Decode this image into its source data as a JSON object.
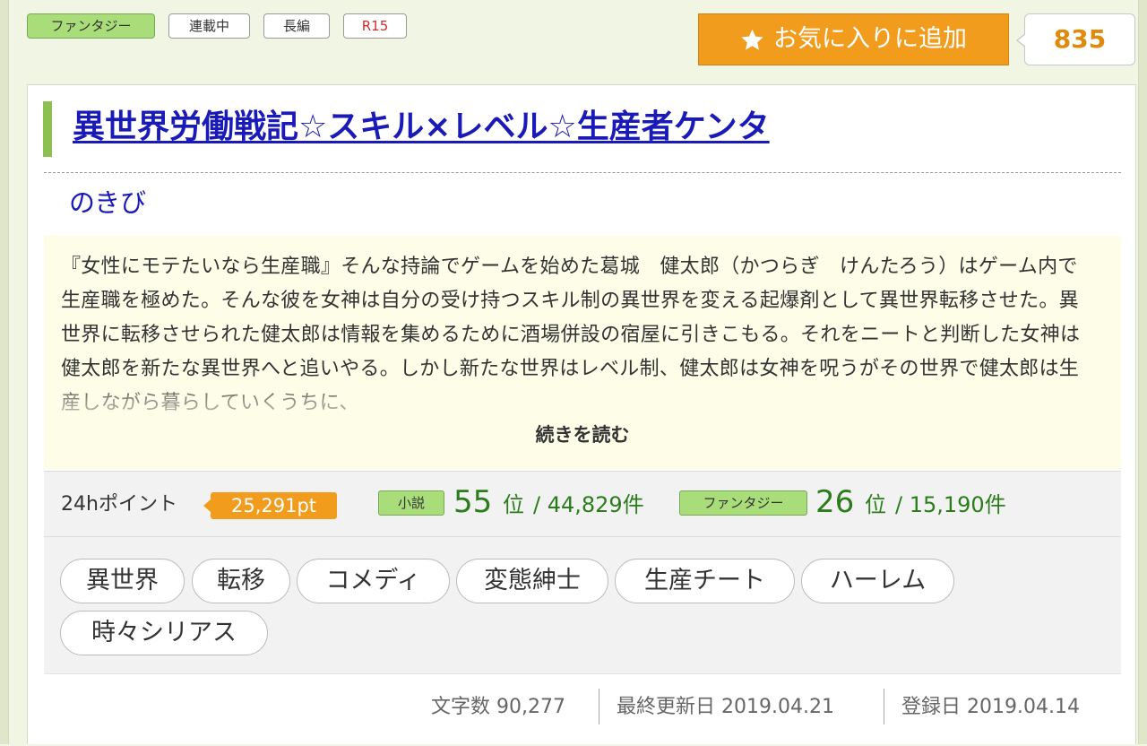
{
  "labels": {
    "genre": "ファンタジー",
    "status": "連載中",
    "length": "長編",
    "rating": "R15"
  },
  "favorite": {
    "button_label": "お気に入りに追加",
    "count": "835",
    "icon": "star-icon"
  },
  "novel": {
    "title": "異世界労働戦記☆スキル×レベル☆生産者ケンタ",
    "author": "のきび",
    "synopsis": "『女性にモテたいなら生産職』そんな持論でゲームを始めた葛城　健太郎（かつらぎ　けんたろう）はゲーム内で生産職を極めた。そんな彼を女神は自分の受け持つスキル制の異世界を変える起爆剤として異世界転移させた。異世界に転移させられた健太郎は情報を集めるために酒場併設の宿屋に引きこもる。それをニートと判断した女神は健太郎を新たな異世界へと追いやる。しかし新たな世界はレベル制、健太郎は女神を呪うがその世界で健太郎は生産しながら暮らしていくうちに、",
    "read_more": "続きを読む"
  },
  "stats": {
    "points_label": "24hポイント",
    "points_value": "25,291pt",
    "rankings": [
      {
        "tag": "小説",
        "rank": "55",
        "unit": "位",
        "total": "/ 44,829件"
      },
      {
        "tag": "ファンタジー",
        "rank": "26",
        "unit": "位",
        "total": "/ 15,190件"
      }
    ]
  },
  "keywords": [
    "異世界",
    "転移",
    "コメディ",
    "変態紳士",
    "生産チート",
    "ハーレム",
    "時々シリアス"
  ],
  "meta": {
    "chars_label": "文字数",
    "chars_value": "90,277",
    "updated_label": "最終更新日",
    "updated_value": "2019.04.21",
    "registered_label": "登録日",
    "registered_value": "2019.04.14"
  },
  "colors": {
    "accent_orange": "#f29c1e",
    "genre_green": "#a9dd7a",
    "title_blue": "#1a1ab8",
    "rank_green": "#2a7d1a",
    "rating_red": "#d52b2b"
  }
}
